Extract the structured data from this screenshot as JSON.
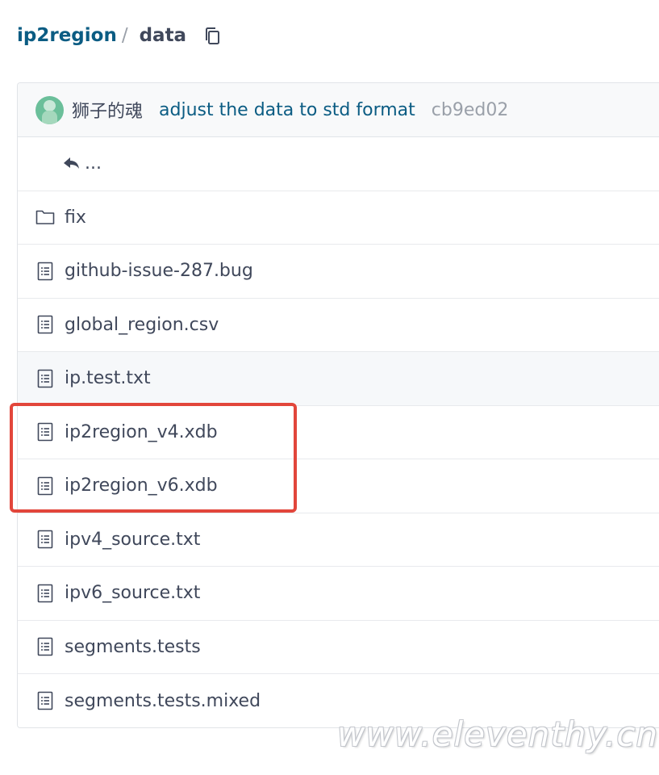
{
  "breadcrumb": {
    "repo": "ip2region",
    "separator": "/",
    "current": "data",
    "copy_icon": "copy-icon"
  },
  "commit": {
    "author": "狮子的魂",
    "message": "adjust the data to std format",
    "sha": "cb9ed02",
    "avatar_icon": "avatar-icon"
  },
  "back_row": {
    "label": "...",
    "icon": "return-arrow-icon"
  },
  "files": [
    {
      "name": "fix",
      "type": "folder",
      "icon": "folder-icon"
    },
    {
      "name": "github-issue-287.bug",
      "type": "file",
      "icon": "file-icon"
    },
    {
      "name": "global_region.csv",
      "type": "file",
      "icon": "file-icon"
    },
    {
      "name": "ip.test.txt",
      "type": "file",
      "icon": "file-icon",
      "hovered": true
    },
    {
      "name": "ip2region_v4.xdb",
      "type": "file",
      "icon": "file-icon",
      "highlighted": true
    },
    {
      "name": "ip2region_v6.xdb",
      "type": "file",
      "icon": "file-icon",
      "highlighted": true
    },
    {
      "name": "ipv4_source.txt",
      "type": "file",
      "icon": "file-icon"
    },
    {
      "name": "ipv6_source.txt",
      "type": "file",
      "icon": "file-icon"
    },
    {
      "name": "segments.tests",
      "type": "file",
      "icon": "file-icon"
    },
    {
      "name": "segments.tests.mixed",
      "type": "file",
      "icon": "file-icon"
    }
  ],
  "colors": {
    "link": "#0b5c83",
    "text": "#40485b",
    "muted": "#9aa0a9",
    "highlight_box": "#e2463b"
  },
  "watermark": "www.eleventhy.cn"
}
